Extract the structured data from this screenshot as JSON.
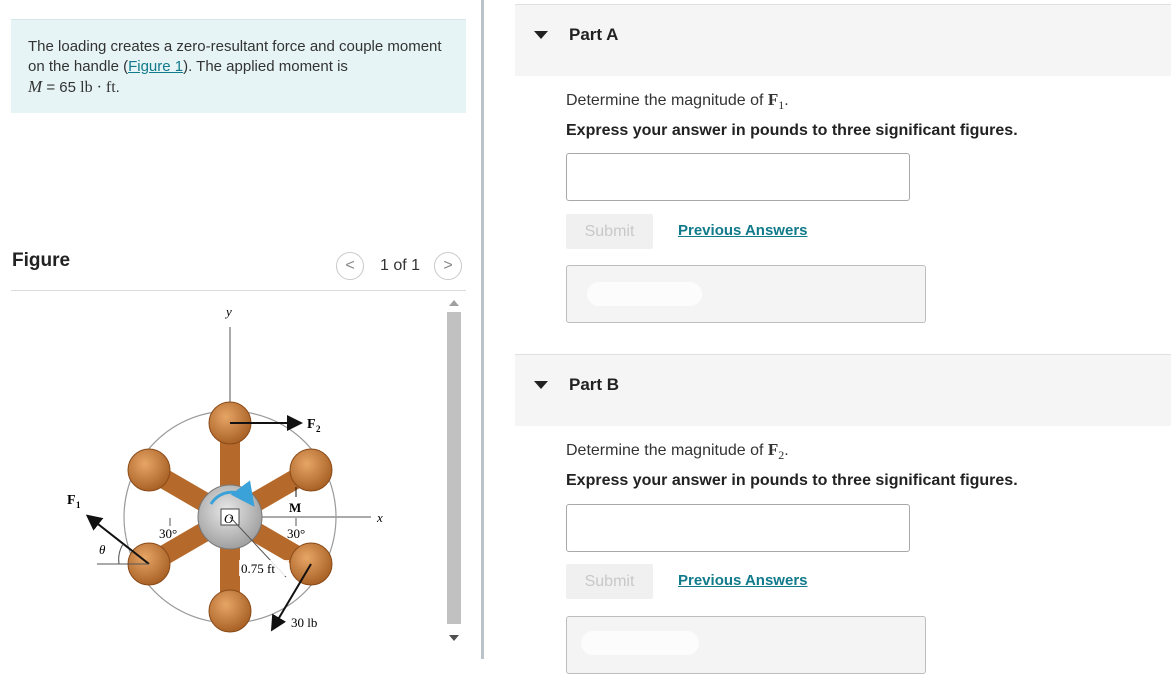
{
  "problem": {
    "text_before_link": "The loading creates a zero-resultant force and couple moment on the handle (",
    "link": "Figure 1",
    "text_after_link": "). The applied moment is",
    "moment_symbol": "M",
    "moment_value": " = 65 ",
    "moment_unit": "lb · ft",
    "period": "."
  },
  "figure": {
    "title": "Figure",
    "counter": "1 of 1",
    "prev_glyph": "<",
    "next_glyph": ">",
    "labels": {
      "y_axis": "y",
      "x_axis": "x",
      "f1": "F",
      "f1_sub": "1",
      "f2": "F",
      "f2_sub": "2",
      "moment": "M",
      "center": "O",
      "angle_left": "30°",
      "angle_right": "30°",
      "theta": "θ",
      "radius": "0.75 ft",
      "force_30": "30 lb"
    }
  },
  "parts": [
    {
      "title": "Part A",
      "prompt_prefix": "Determine the magnitude of ",
      "prompt_symbol": "F",
      "prompt_sub": "1",
      "prompt_suffix": ".",
      "instruction": "Express your answer in pounds to three significant figures.",
      "submit": "Submit",
      "previous_answers": "Previous Answers"
    },
    {
      "title": "Part B",
      "prompt_prefix": "Determine the magnitude of ",
      "prompt_symbol": "F",
      "prompt_sub": "2",
      "prompt_suffix": ".",
      "instruction": "Express your answer in pounds to three significant figures.",
      "submit": "Submit",
      "previous_answers": "Previous Answers"
    }
  ],
  "colors": {
    "handle_brown": "#b5692a",
    "handle_highlight": "#e6a565",
    "moment_arrow": "#3aa2d8",
    "link_teal": "#117a8b",
    "problem_bg": "#e6f4f5"
  }
}
